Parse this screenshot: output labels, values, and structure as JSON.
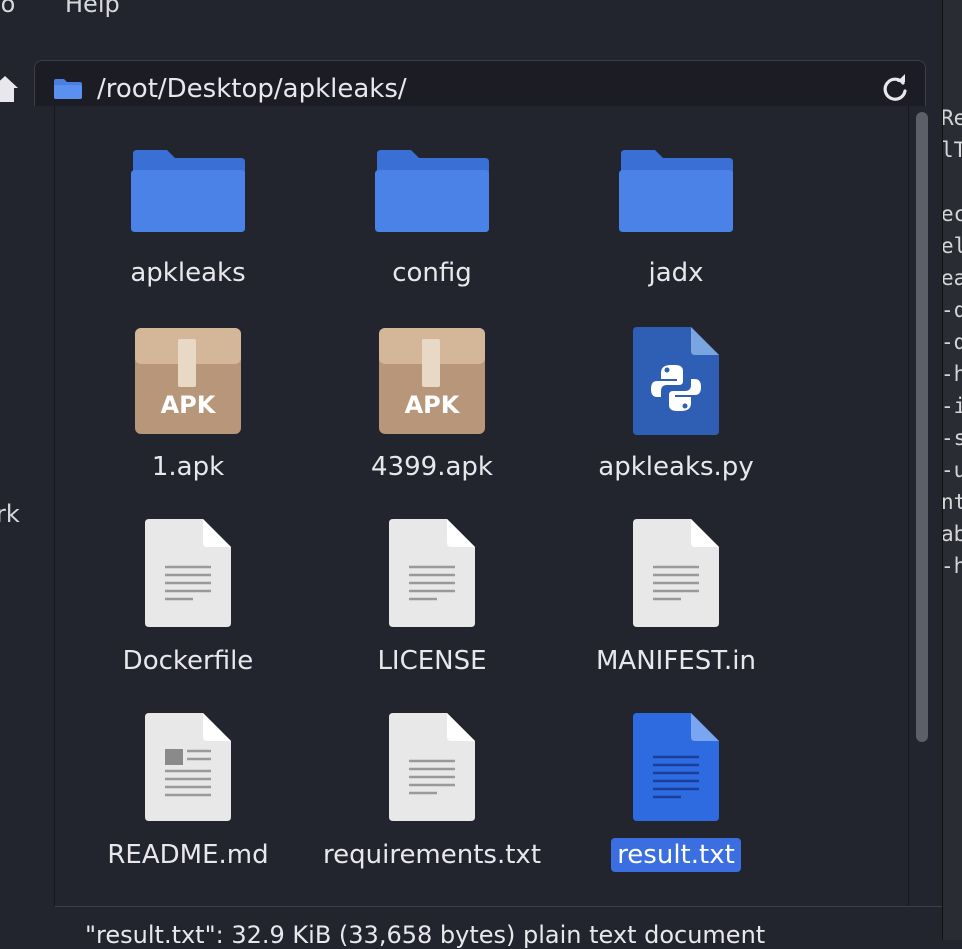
{
  "menu": {
    "go": "Go",
    "help": "Help"
  },
  "location": {
    "path": "/root/Desktop/apkleaks/"
  },
  "sidebar": {
    "partial_label": "rk"
  },
  "files": [
    {
      "name": "apkleaks",
      "icon": "folder-icon"
    },
    {
      "name": "config",
      "icon": "folder-icon"
    },
    {
      "name": "jadx",
      "icon": "folder-icon"
    },
    {
      "name": "1.apk",
      "icon": "apk-package-icon"
    },
    {
      "name": "4399.apk",
      "icon": "apk-package-icon"
    },
    {
      "name": "apkleaks.py",
      "icon": "python-file-icon"
    },
    {
      "name": "Dockerfile",
      "icon": "text-file-icon"
    },
    {
      "name": "LICENSE",
      "icon": "text-file-icon"
    },
    {
      "name": "MANIFEST.in",
      "icon": "text-file-icon"
    },
    {
      "name": "README.md",
      "icon": "markdown-file-icon"
    },
    {
      "name": "requirements.txt",
      "icon": "text-file-icon"
    },
    {
      "name": "result.txt",
      "icon": "selected-text-file-icon",
      "selected": true
    }
  ],
  "status": {
    "text": "\"result.txt\": 32.9 KiB (33,658 bytes) plain text document"
  },
  "background_terminal": {
    "lines": [
      "Re",
      "lT",
      "",
      "ec",
      "el",
      "ea",
      "-q",
      "-d",
      "-h",
      "-i",
      "-s",
      "-u",
      "nt",
      "ab",
      "-h"
    ]
  },
  "colors": {
    "accent": "#3b6ee0",
    "folder": "#4a7fe0",
    "apk_box": "#c6a585",
    "python_file": "#2f5fb5"
  }
}
